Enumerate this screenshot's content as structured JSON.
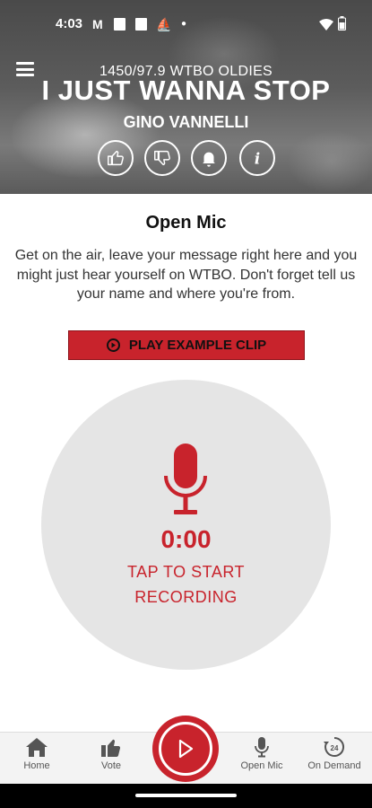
{
  "statusbar": {
    "time": "4:03"
  },
  "header": {
    "station": "1450/97.9 WTBO OLDIES",
    "song": "I JUST WANNA STOP",
    "artist": "GINO VANNELLI"
  },
  "content": {
    "title": "Open Mic",
    "description": "Get on the air, leave your message right here and you might just hear yourself on WTBO. Don't forget tell us your name and where you're from.",
    "play_example_label": "PLAY EXAMPLE CLIP",
    "timer": "0:00",
    "tap_line1": "TAP TO START",
    "tap_line2": "RECORDING"
  },
  "nav": {
    "home": "Home",
    "vote": "Vote",
    "open_mic": "Open Mic",
    "on_demand": "On Demand",
    "on_demand_badge": "24"
  },
  "colors": {
    "accent": "#c8232c",
    "record_bg": "#e5e5e5"
  },
  "icons": [
    "menu-icon",
    "thumbs-up-icon",
    "thumbs-down-icon",
    "bell-icon",
    "info-icon",
    "play-icon",
    "microphone-icon",
    "home-icon",
    "vote-icon",
    "on-demand-icon",
    "wifi-icon",
    "battery-icon"
  ]
}
